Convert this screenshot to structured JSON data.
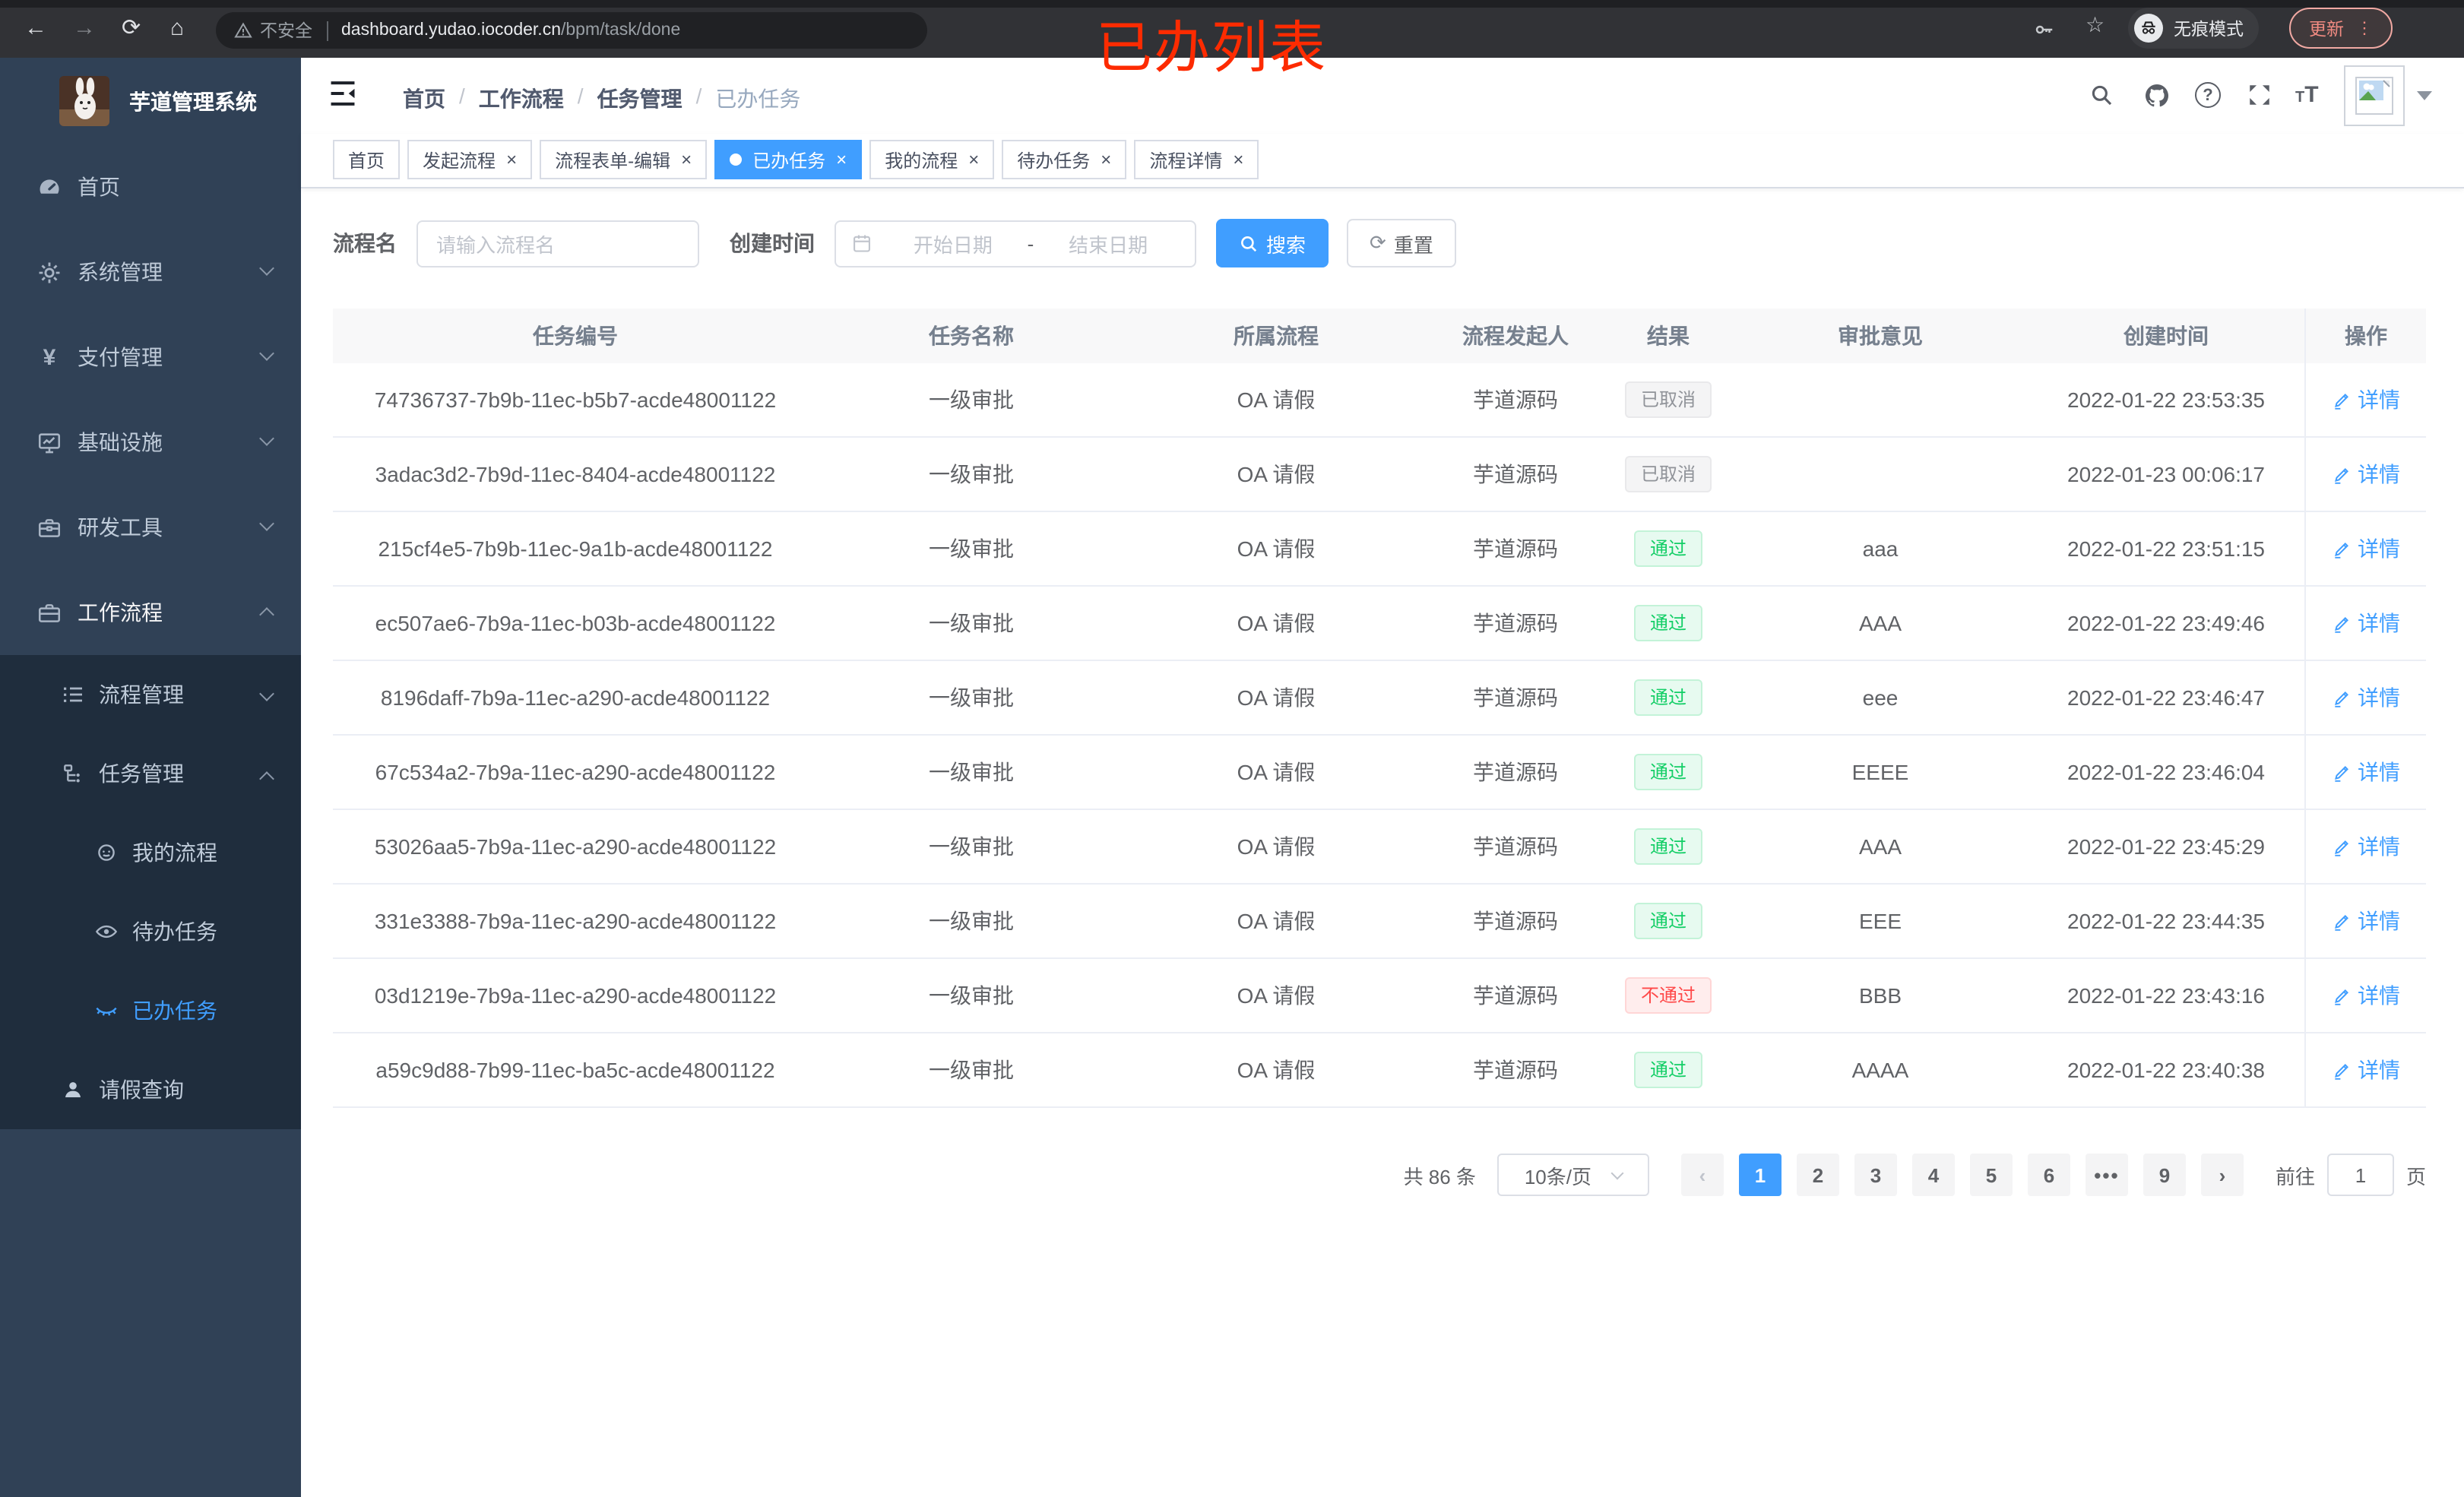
{
  "browser": {
    "security_label": "不安全",
    "url_host": "dashboard.yudao.iocoder.cn",
    "url_path": "/bpm/task/done",
    "incognito_label": "无痕模式",
    "update_label": "更新"
  },
  "annotation": {
    "text": "已办列表",
    "color": "#FD2B01"
  },
  "sidebar": {
    "title": "芋道管理系统",
    "items": [
      {
        "label": "首页"
      },
      {
        "label": "系统管理"
      },
      {
        "label": "支付管理"
      },
      {
        "label": "基础设施"
      },
      {
        "label": "研发工具"
      },
      {
        "label": "工作流程"
      }
    ],
    "submenu": [
      {
        "label": "流程管理"
      },
      {
        "label": "任务管理"
      },
      {
        "label": "我的流程"
      },
      {
        "label": "待办任务"
      },
      {
        "label": "已办任务"
      },
      {
        "label": "请假查询"
      }
    ]
  },
  "header": {
    "breadcrumb": [
      "首页",
      "工作流程",
      "任务管理",
      "已办任务"
    ]
  },
  "tabs": [
    {
      "label": "首页"
    },
    {
      "label": "发起流程"
    },
    {
      "label": "流程表单-编辑"
    },
    {
      "label": "已办任务"
    },
    {
      "label": "我的流程"
    },
    {
      "label": "待办任务"
    },
    {
      "label": "流程详情"
    }
  ],
  "filters": {
    "name_label": "流程名",
    "name_placeholder": "请输入流程名",
    "time_label": "创建时间",
    "start_placeholder": "开始日期",
    "separator": "-",
    "end_placeholder": "结束日期",
    "search_label": "搜索",
    "reset_label": "重置"
  },
  "table": {
    "columns": [
      "任务编号",
      "任务名称",
      "所属流程",
      "流程发起人",
      "结果",
      "审批意见",
      "创建时间",
      "操作"
    ],
    "detail_label": "详情",
    "rows": [
      {
        "id": "74736737-7b9b-11ec-b5b7-acde48001122",
        "name": "一级审批",
        "process": "OA 请假",
        "initiator": "芋道源码",
        "result": "已取消",
        "result_type": "info",
        "comment": "",
        "time": "2022-01-22 23:53:35"
      },
      {
        "id": "3adac3d2-7b9d-11ec-8404-acde48001122",
        "name": "一级审批",
        "process": "OA 请假",
        "initiator": "芋道源码",
        "result": "已取消",
        "result_type": "info",
        "comment": "",
        "time": "2022-01-23 00:06:17"
      },
      {
        "id": "215cf4e5-7b9b-11ec-9a1b-acde48001122",
        "name": "一级审批",
        "process": "OA 请假",
        "initiator": "芋道源码",
        "result": "通过",
        "result_type": "success",
        "comment": "aaa",
        "time": "2022-01-22 23:51:15"
      },
      {
        "id": "ec507ae6-7b9a-11ec-b03b-acde48001122",
        "name": "一级审批",
        "process": "OA 请假",
        "initiator": "芋道源码",
        "result": "通过",
        "result_type": "success",
        "comment": "AAA",
        "time": "2022-01-22 23:49:46"
      },
      {
        "id": "8196daff-7b9a-11ec-a290-acde48001122",
        "name": "一级审批",
        "process": "OA 请假",
        "initiator": "芋道源码",
        "result": "通过",
        "result_type": "success",
        "comment": "eee",
        "time": "2022-01-22 23:46:47"
      },
      {
        "id": "67c534a2-7b9a-11ec-a290-acde48001122",
        "name": "一级审批",
        "process": "OA 请假",
        "initiator": "芋道源码",
        "result": "通过",
        "result_type": "success",
        "comment": "EEEE",
        "time": "2022-01-22 23:46:04"
      },
      {
        "id": "53026aa5-7b9a-11ec-a290-acde48001122",
        "name": "一级审批",
        "process": "OA 请假",
        "initiator": "芋道源码",
        "result": "通过",
        "result_type": "success",
        "comment": "AAA",
        "time": "2022-01-22 23:45:29"
      },
      {
        "id": "331e3388-7b9a-11ec-a290-acde48001122",
        "name": "一级审批",
        "process": "OA 请假",
        "initiator": "芋道源码",
        "result": "通过",
        "result_type": "success",
        "comment": "EEE",
        "time": "2022-01-22 23:44:35"
      },
      {
        "id": "03d1219e-7b9a-11ec-a290-acde48001122",
        "name": "一级审批",
        "process": "OA 请假",
        "initiator": "芋道源码",
        "result": "不通过",
        "result_type": "danger",
        "comment": "BBB",
        "time": "2022-01-22 23:43:16"
      },
      {
        "id": "a59c9d88-7b99-11ec-ba5c-acde48001122",
        "name": "一级审批",
        "process": "OA 请假",
        "initiator": "芋道源码",
        "result": "通过",
        "result_type": "success",
        "comment": "AAAA",
        "time": "2022-01-22 23:40:38"
      }
    ]
  },
  "pagination": {
    "total_text": "共 86 条",
    "page_size": "10条/页",
    "pages": [
      "1",
      "2",
      "3",
      "4",
      "5",
      "6",
      "•••",
      "9"
    ],
    "active_page": "1",
    "prev": "‹",
    "next": "›",
    "goto_label": "前往",
    "goto_value": "1",
    "page_suffix": "页"
  },
  "colors": {
    "accent": "#409EFF",
    "success": "#13CE66",
    "danger": "#FF4949",
    "info": "#909399",
    "sidebar_bg": "#304156",
    "submenu_bg": "#1F2D3D",
    "annotation_red": "#FD2B01"
  }
}
